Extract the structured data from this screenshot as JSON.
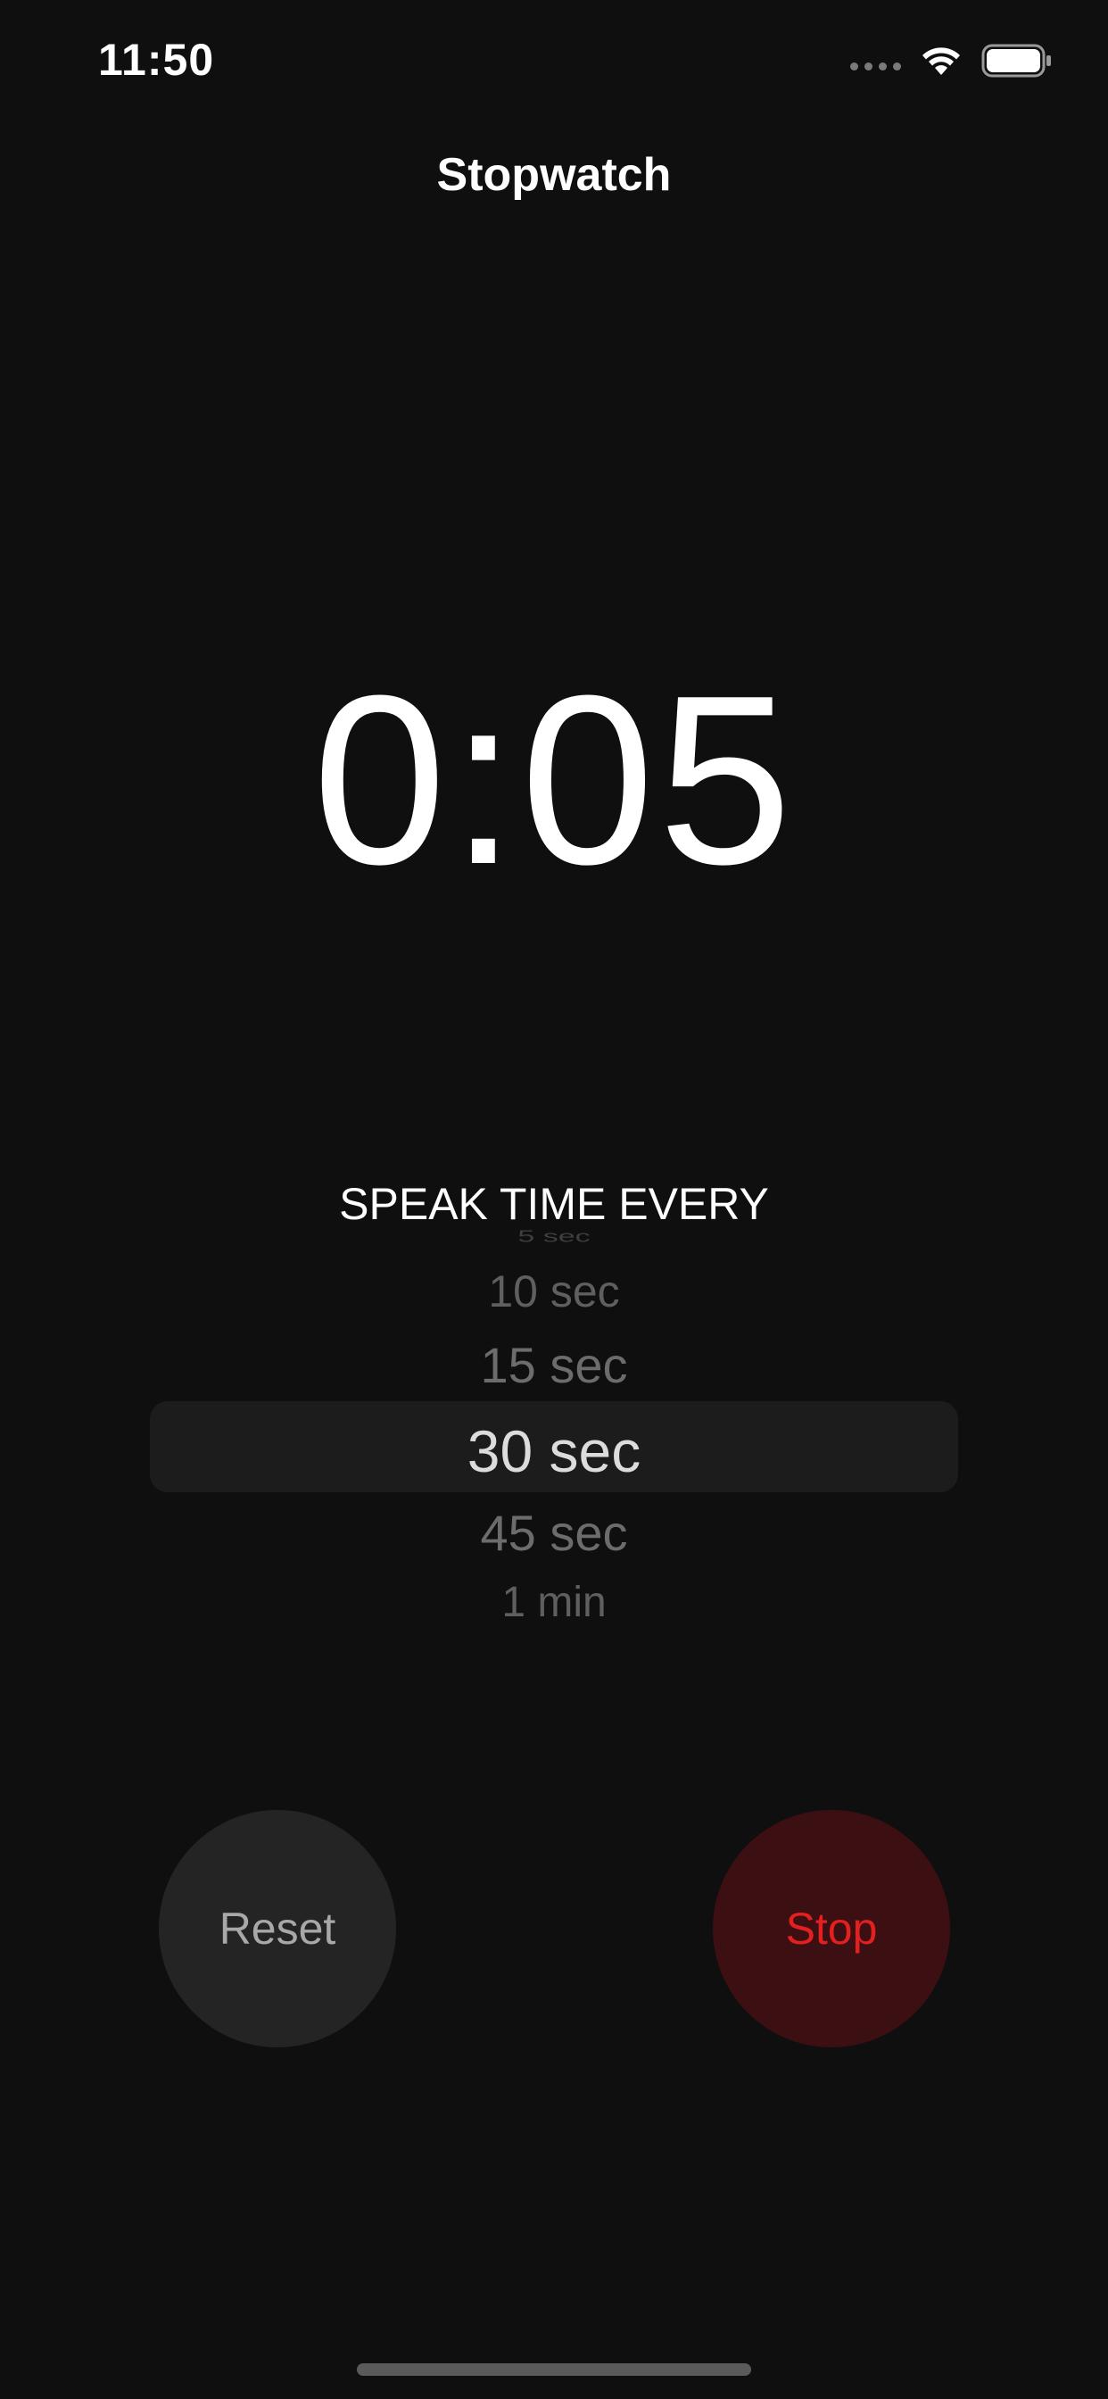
{
  "status_bar": {
    "time": "11:50",
    "icons": [
      "signal-icon",
      "wifi-icon",
      "battery-icon"
    ]
  },
  "header": {
    "title": "Stopwatch"
  },
  "timer": {
    "display": "0:05"
  },
  "speak_time": {
    "label": "SPEAK TIME EVERY",
    "options": [
      "5 sec",
      "10 sec",
      "15 sec",
      "30 sec",
      "45 sec",
      "1 min"
    ],
    "selected": "30 sec"
  },
  "controls": {
    "reset_label": "Reset",
    "stop_label": "Stop"
  },
  "colors": {
    "background": "#0f0f0f",
    "stop_text": "#e3201f",
    "stop_bg": "#3c0f13",
    "reset_bg": "#242424"
  }
}
